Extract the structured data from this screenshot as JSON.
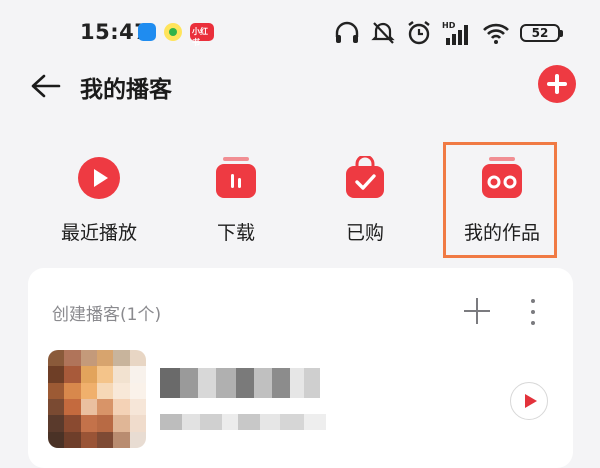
{
  "status_bar": {
    "time": "15:47",
    "red_app_text": "小红书",
    "battery": "52",
    "icons": [
      "headphones-icon",
      "mute-icon",
      "alarm-icon",
      "hd-signal-icon",
      "wifi-icon",
      "battery-icon"
    ]
  },
  "header": {
    "title": "我的播客",
    "back_icon": "arrow-left-icon",
    "add_icon": "plus-icon"
  },
  "quick_entries": [
    {
      "label": "最近播放",
      "icon": "play-circle-icon"
    },
    {
      "label": "下载",
      "icon": "download-icon"
    },
    {
      "label": "已购",
      "icon": "shopping-bag-icon"
    },
    {
      "label": "我的作品",
      "icon": "radio-icon",
      "highlighted": true
    }
  ],
  "created_section": {
    "title": "创建播客(1个)",
    "add_icon": "plus-icon",
    "more_icon": "more-vertical-icon"
  },
  "colors": {
    "accent": "#ee3a42",
    "highlight_border": "#f07a44",
    "background": "#f4f4f6"
  }
}
